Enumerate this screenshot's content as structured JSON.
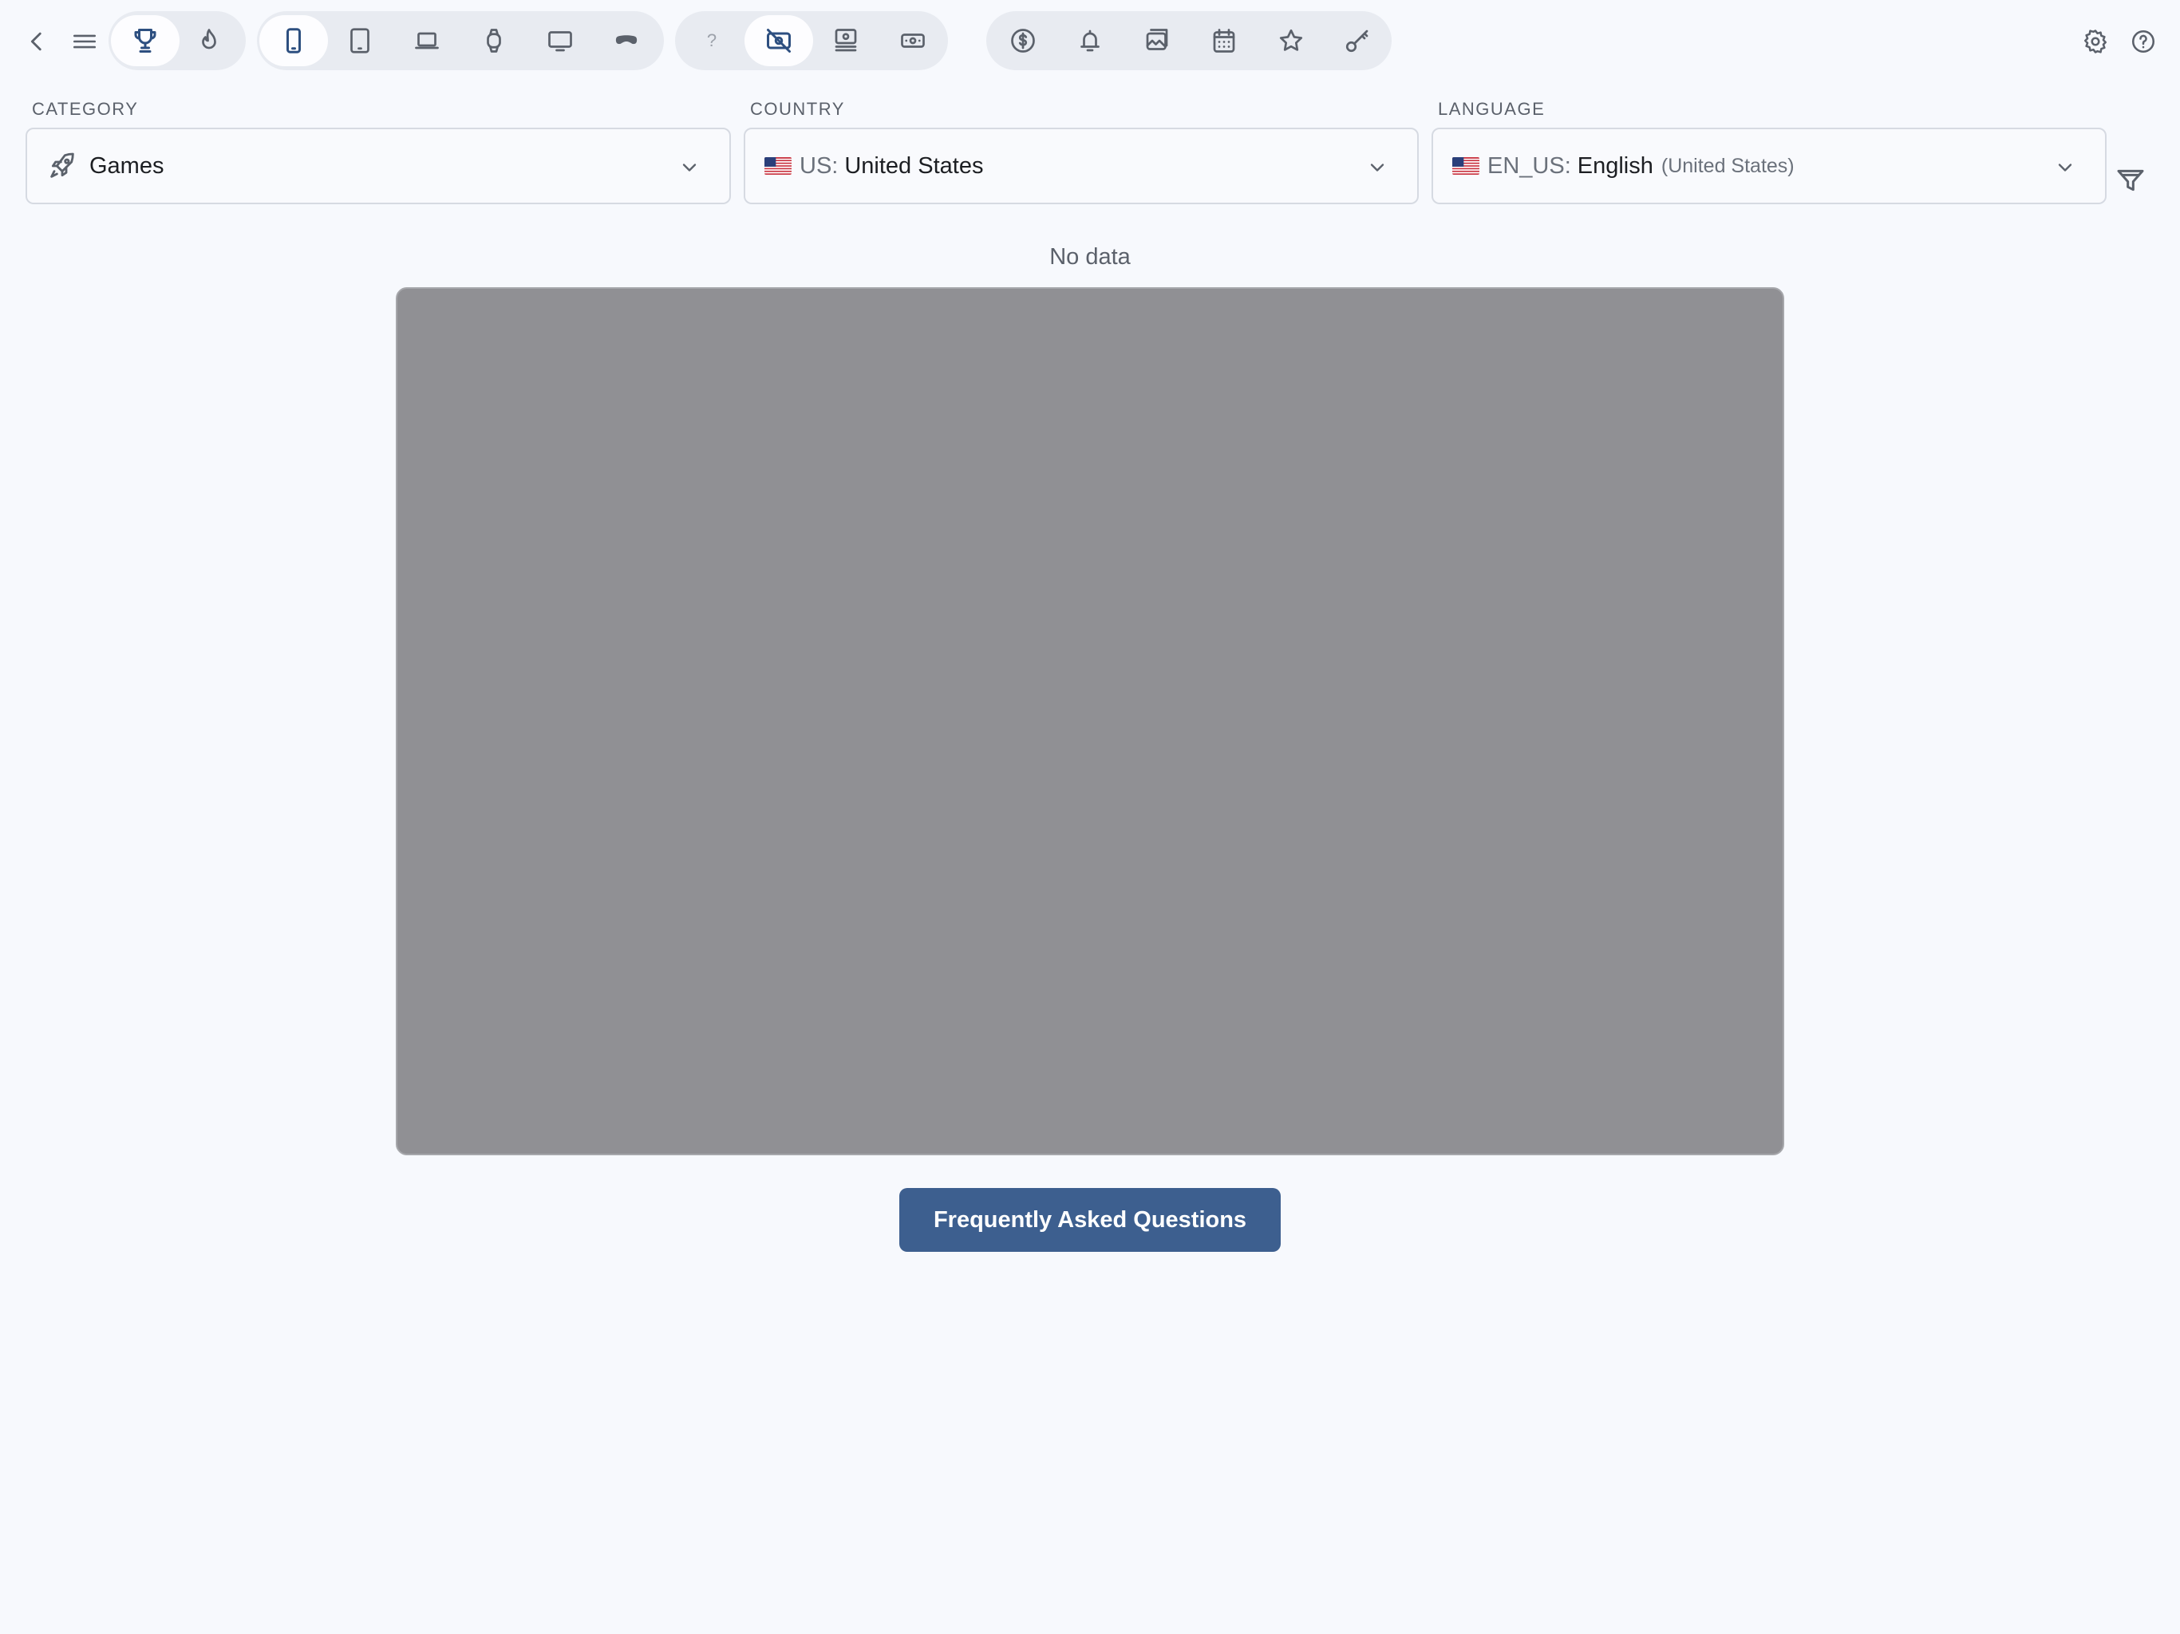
{
  "toolbar": {
    "nav": [
      {
        "icon": "chevron-left-icon"
      },
      {
        "icon": "menu-icon"
      }
    ],
    "ranking_group": [
      {
        "icon": "trophy-icon",
        "active": true
      },
      {
        "icon": "flame-icon",
        "active": false
      }
    ],
    "device_group": [
      {
        "icon": "iphone-icon",
        "active": true
      },
      {
        "icon": "ipad-icon",
        "active": false
      },
      {
        "icon": "mac-icon",
        "active": false
      },
      {
        "icon": "watch-icon",
        "active": false
      },
      {
        "icon": "tv-icon",
        "active": false
      },
      {
        "icon": "vision-headset-icon",
        "active": false
      }
    ],
    "price_group": [
      {
        "icon": "unknown-icon",
        "text": "?",
        "active": false
      },
      {
        "icon": "free-icon",
        "active": true
      },
      {
        "icon": "paid-icon",
        "active": false
      },
      {
        "icon": "in-app-purchase-icon",
        "active": false
      }
    ],
    "feature_group": [
      {
        "icon": "dollar-circle-icon"
      },
      {
        "icon": "bell-icon"
      },
      {
        "icon": "image-icon"
      },
      {
        "icon": "calendar-icon"
      },
      {
        "icon": "star-icon"
      },
      {
        "icon": "key-icon"
      }
    ],
    "right": [
      {
        "icon": "gear-icon"
      },
      {
        "icon": "help-circle-icon"
      }
    ]
  },
  "filters": {
    "category": {
      "label": "CATEGORY",
      "value": "Games",
      "icon": "rocket-icon"
    },
    "country": {
      "label": "COUNTRY",
      "code": "US:",
      "value": "United States",
      "flag": "us-flag-icon"
    },
    "language": {
      "label": "LANGUAGE",
      "code": "EN_US:",
      "value": "English",
      "sub": "(United States)",
      "flag": "us-flag-icon"
    }
  },
  "content": {
    "empty_text": "No data",
    "faq_label": "Frequently Asked Questions"
  },
  "colors": {
    "accent": "#3d5f8f",
    "icon": "#5b616b",
    "active_icon": "#2d4f80",
    "background": "#f7f9fd",
    "placeholder": "#909094"
  }
}
